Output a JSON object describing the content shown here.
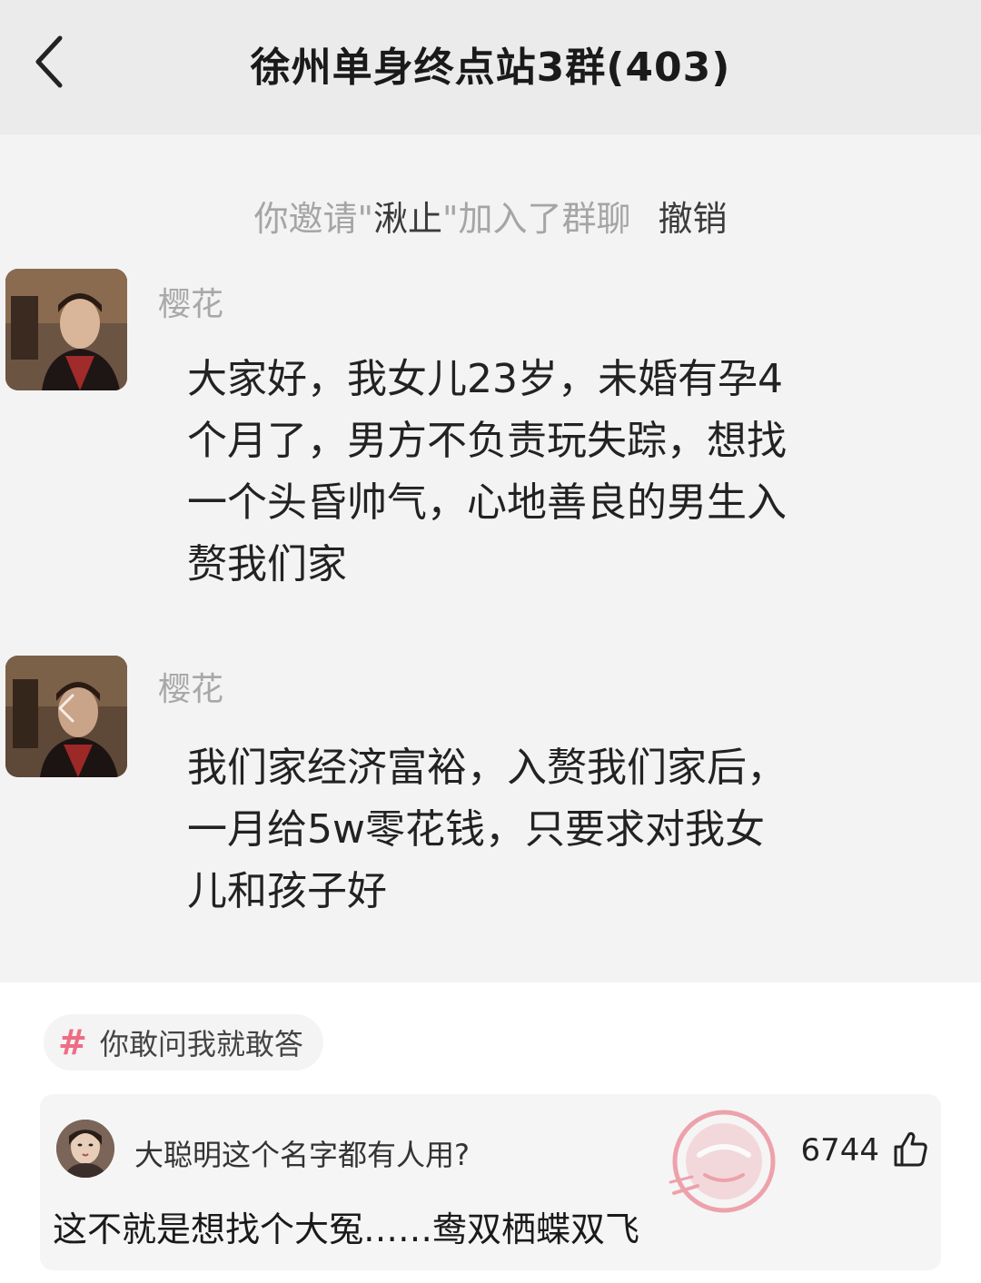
{
  "header": {
    "back_icon": "chevron-left-icon",
    "title": "徐州单身终点站3群(403)"
  },
  "system_notice": {
    "prefix": "你邀请\"",
    "invitee": "湫止",
    "suffix": "\"加入了群聊",
    "action": "撤销"
  },
  "messages": [
    {
      "sender": "樱花",
      "text": "大家好，我女儿23岁，未婚有孕4\n个月了，男方不负责玩失踪，想找\n一个头昏帅气，心地善良的男生入\n赘我们家"
    },
    {
      "sender": "樱花",
      "text": "我们家经济富裕，入赘我们家后，\n一月给5w零花钱，只要求对我女\n儿和孩子好"
    }
  ],
  "topic": {
    "icon": "hashtag-icon",
    "label": "你敢问我就敢答"
  },
  "comment": {
    "question": "大聪明这个名字都有人用?",
    "likes": "6744",
    "like_icon": "thumbs-up-icon",
    "answer": "这不就是想找个大冤……鸯双栖蝶双飞"
  },
  "colors": {
    "nav_bg": "#ebebeb",
    "chat_bg": "#f3f3f3",
    "muted_text": "#a8a8a8",
    "topic_accent": "#ef6d84",
    "watermark": "#e8606f"
  }
}
